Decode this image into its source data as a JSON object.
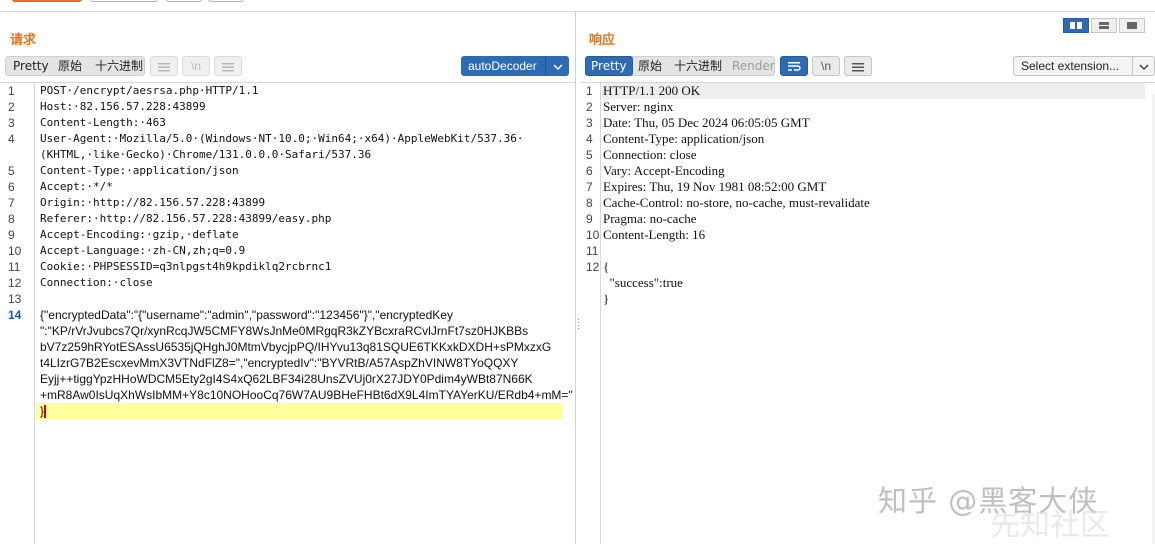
{
  "request": {
    "title": "请求",
    "tabs": [
      "Pretty",
      "原始",
      "十六进制"
    ],
    "tab_icons": [
      "wrap-lines-icon",
      "newline-icon",
      "menu-icon"
    ],
    "decoder_label": "autoDecoder",
    "line_numbers": [
      "1",
      "2",
      "3",
      "4",
      "",
      "5",
      "6",
      "7",
      "8",
      "9",
      "10",
      "11",
      "12",
      "13",
      "14"
    ],
    "lines": [
      "POST·/encrypt/aesrsa.php·HTTP/1.1",
      "Host:·82.156.57.228:43899",
      "Content-Length:·463",
      "User-Agent:·Mozilla/5.0·(Windows·NT·10.0;·Win64;·x64)·AppleWebKit/537.36·",
      "(KHTML,·like·Gecko)·Chrome/131.0.0.0·Safari/537.36",
      "Content-Type:·application/json",
      "Accept:·*/*",
      "Origin:·http://82.156.57.228:43899",
      "Referer:·http://82.156.57.228:43899/easy.php",
      "Accept-Encoding:·gzip,·deflate",
      "Accept-Language:·zh-CN,zh;q=0.9",
      "Cookie:·PHPSESSID=q3nlpgst4h9kpdiklq2rcbrnc1",
      "Connection:·close"
    ],
    "body_lines": [
      "{\"encryptedData\":\"{\"username\":\"admin\",\"password\":\"123456\"}\",\"encryptedKey",
      "\":\"KP/rVrJvubcs7Qr/xynRcqJW5CMFY8WsJnMe0MRgqR3kZYBcxraRCvlJrnFt7sz0HJKBBs",
      "bV7z259hRYotESAssU6535jQHghJ0MtmVbycjpPQ/IHYvu13q81SQUE6TKKxkDXDH+sPMxzxG",
      "t4LIzrG7B2EscxevMmX3VTNdFlZ8=\",\"encryptedIv\":\"BYVRtB/A57AspZhVINW8TYoQQXY",
      "Eyjj++tiggYpzHHoWDCM5Ety2gI4S4xQ62LBF34i28UnsZVUj0rX27JDY0Pdim4yWBt87N66K",
      "+mR8Aw0IsUqXhWsIbMM+Y8c10NOHooCq76W7AU9BHeFHBt6dX9L4ImTYAYerKU/ERdb4+mM=\"",
      "}"
    ]
  },
  "response": {
    "title": "响应",
    "tabs": [
      "Pretty",
      "原始",
      "十六进制",
      "Render"
    ],
    "tab_icons": [
      "wrap-lines-icon",
      "newline-icon",
      "menu-icon"
    ],
    "select_label": "Select extension...",
    "line_numbers": [
      "1",
      "2",
      "3",
      "4",
      "5",
      "6",
      "7",
      "8",
      "9",
      "10",
      "11",
      "12"
    ],
    "lines": [
      "HTTP/1.1 200 OK",
      "Server: nginx",
      "Date: Thu, 05 Dec 2024 06:05:05 GMT",
      "Content-Type: application/json",
      "Connection: close",
      "Vary: Accept-Encoding",
      "Expires: Thu, 19 Nov 1981 08:52:00 GMT",
      "Cache-Control: no-store, no-cache, must-revalidate",
      "Pragma: no-cache",
      "Content-Length: 16",
      "",
      "{",
      "  \"success\":true",
      "}"
    ]
  },
  "newline_label": "\\n",
  "watermark": "知乎 @黑客大侠",
  "watermark2": "先知社区",
  "colors": {
    "accent": "#2d6bb5",
    "title": "#e8731b",
    "highlight": "#ffff9c"
  }
}
